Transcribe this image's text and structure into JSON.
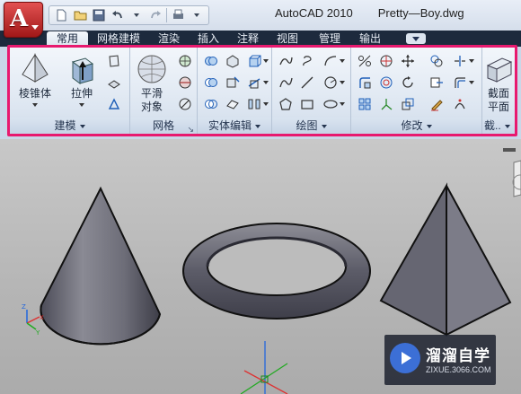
{
  "window": {
    "app_title": "AutoCAD 2010",
    "document_title": "Pretty—Boy.dwg"
  },
  "app_menu": {
    "icon": "autocad-a-logo-icon"
  },
  "quick_access": [
    {
      "name": "new-icon"
    },
    {
      "name": "open-icon"
    },
    {
      "name": "save-icon"
    },
    {
      "name": "undo-icon"
    },
    {
      "name": "redo-icon"
    },
    {
      "name": "plot-icon"
    }
  ],
  "tabs": [
    {
      "label": "常用",
      "active": true
    },
    {
      "label": "网格建模"
    },
    {
      "label": "渲染"
    },
    {
      "label": "插入"
    },
    {
      "label": "注释"
    },
    {
      "label": "视图"
    },
    {
      "label": "管理"
    },
    {
      "label": "输出"
    }
  ],
  "ribbon": {
    "panels": [
      {
        "title": "建模",
        "buttons": [
          {
            "label": "棱锥体",
            "icon": "pyramid-icon"
          },
          {
            "label": "拉伸",
            "icon": "extrude-icon"
          }
        ]
      },
      {
        "title": "网格",
        "buttons": [
          {
            "label": "平滑\n对象",
            "icon": "smooth-object-icon"
          }
        ]
      },
      {
        "title": "实体编辑"
      },
      {
        "title": "绘图"
      },
      {
        "title": "修改"
      },
      {
        "title": "截..",
        "buttons": [
          {
            "label": "截面\n平面",
            "icon": "section-plane-icon"
          }
        ]
      }
    ]
  },
  "watermark": {
    "text": "溜溜自学",
    "url": "ZIXUE.3066.COM"
  }
}
